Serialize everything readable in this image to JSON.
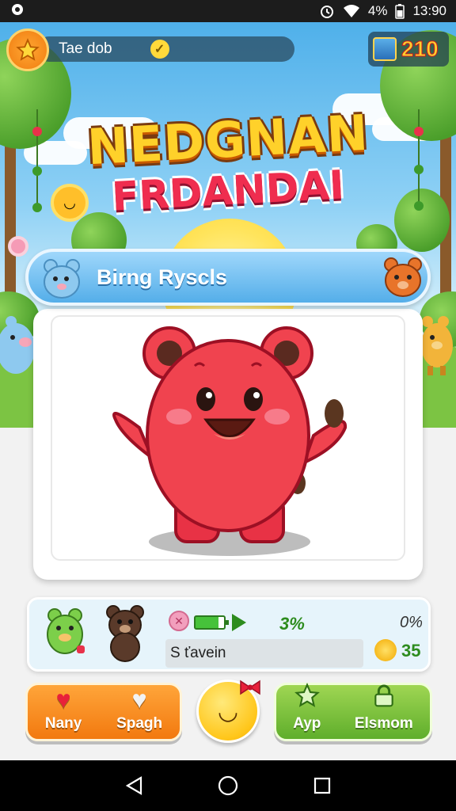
{
  "status_bar": {
    "percent": "4%",
    "time": "13:90",
    "icons": [
      "notification-icon",
      "alarm-icon",
      "wifi-icon",
      "battery-icon"
    ]
  },
  "hud": {
    "player_name": "Tae dob",
    "coins": "210"
  },
  "title": {
    "line1": "NEDGNAN",
    "line2": "FRDANDAI"
  },
  "section": {
    "label": "Birng Ryscls"
  },
  "info": {
    "progress_label": "3%",
    "right_percent": "0%",
    "status_text": "S ťavein",
    "score": "35"
  },
  "buttons": {
    "left": [
      {
        "icon": "heart-icon",
        "label": "Nany"
      },
      {
        "icon": "heart-outline-icon",
        "label": "Spagh"
      }
    ],
    "right": [
      {
        "icon": "star-badge-icon",
        "label": "Ayp"
      },
      {
        "icon": "lock-icon",
        "label": "Elsmom"
      }
    ]
  },
  "colors": {
    "accent_orange": "#f2790f",
    "accent_green": "#5fae2b",
    "banner_blue": "#54aee9",
    "mascot_red": "#f0434f"
  }
}
